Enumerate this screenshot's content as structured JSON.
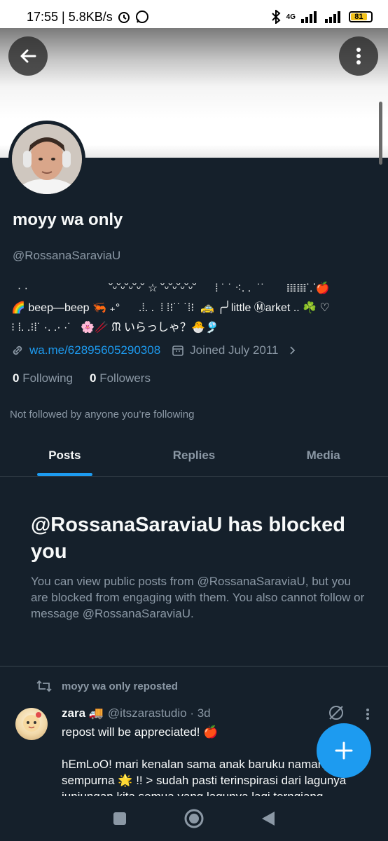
{
  "status": {
    "time_speed": "17:55 | 5.8KB/s",
    "network": "4G",
    "battery": "81"
  },
  "profile": {
    "name": "moyy wa only",
    "handle": "@RossanaSaraviaU",
    "bio": "  · ·                          ˘ᵕ˘ᵕ˘ᵕ˘ᵕ˘ ☆ ˘ᵕ˘ᵕ˘ᵕ˘ᵕ˘      ⁞ ˙ ˙ ⁖. .  ˙˙       𝍖𝍖⸪🍎\n🌈 beep—beep 🦐 ₊°      .⁞. .  ⁞ ⁞⁝˙˙ ˙⁞⁝  🚕 ╭╯little Ⓜarket .. ☘️ ♡\n⁝ ⁞. .⁝⁞˙ ·. .· ·˙   🌸🥢 ᙏ いらっしゃ？🐣🎐",
    "link": "wa.me/62895605290308",
    "joined": "Joined July 2011",
    "following_count": "0",
    "following_label": "Following",
    "followers_count": "0",
    "followers_label": "Followers",
    "not_followed": "Not followed by anyone you’re following"
  },
  "tabs": [
    "Posts",
    "Replies",
    "Media"
  ],
  "blocked": {
    "title": "@RossanaSaraviaU has blocked you",
    "message": "You can view public posts from @RossanaSaraviaU, but you are blocked from engaging with them. You also cannot follow or message @RossanaSaraviaU."
  },
  "post": {
    "repost_label": "moyy wa only reposted",
    "user": "zara 🚚",
    "handle_time": "@itszarastudio · 3d",
    "body": "repost will be appreciated! 🍎\n\nhEmLoO! mari kenalan sama anak baruku namanya sempurna 🌟 !! > sudah pasti terinspirasi dari lagunya junjungan kita semua yang lagunya lagi terngiang-ngiang"
  },
  "icons": {
    "back": "back-arrow-icon",
    "more": "more-vertical-icon",
    "link": "link-icon",
    "calendar": "calendar-icon",
    "chevron": "chevron-right-icon",
    "repost": "repost-icon",
    "grok": "grok-icon",
    "compose": "plus-icon"
  },
  "colors": {
    "background": "#15202b",
    "accent": "#1d9bf0",
    "secondary_text": "#8b98a5"
  }
}
